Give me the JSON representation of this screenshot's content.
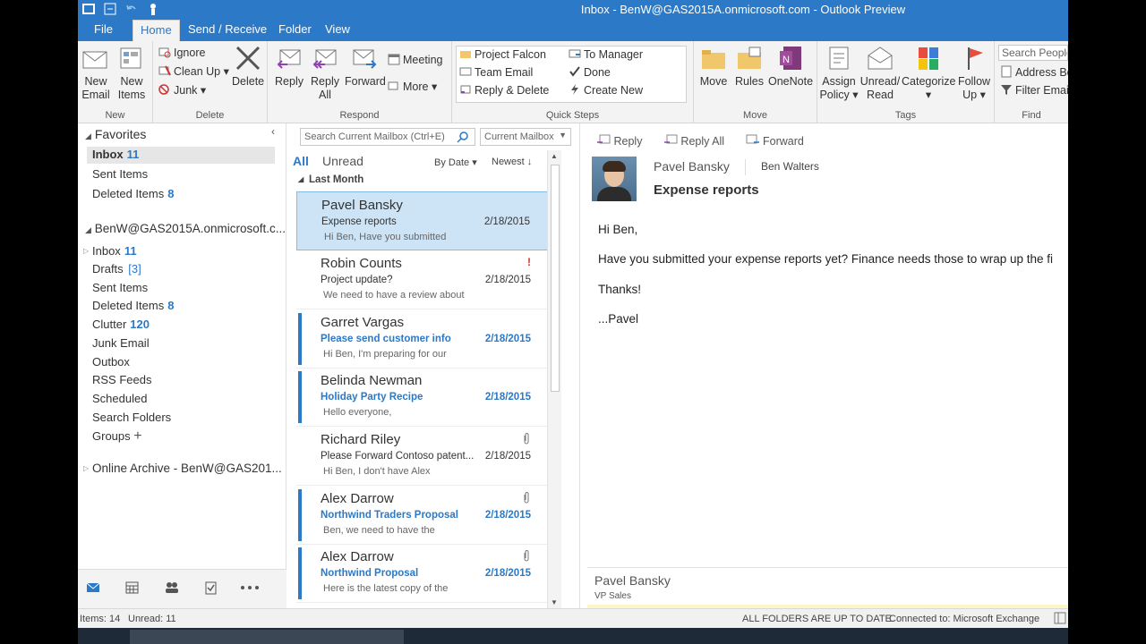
{
  "window": {
    "title": "Inbox - BenW@GAS2015A.onmicrosoft.com - Outlook Preview"
  },
  "tabs": [
    "File",
    "Home",
    "Send / Receive",
    "Folder",
    "View"
  ],
  "ribbon": {
    "new_email": "New Email",
    "new_items": "New Items",
    "group_new": "New",
    "ignore": "Ignore",
    "clean_up": "Clean Up",
    "junk": "Junk",
    "delete": "Delete",
    "group_delete": "Delete",
    "reply": "Reply",
    "reply_all": "Reply All",
    "forward": "Forward",
    "meeting": "Meeting",
    "more": "More",
    "group_respond": "Respond",
    "qs_project_falcon": "Project Falcon",
    "qs_team_email": "Team Email",
    "qs_reply_delete": "Reply & Delete",
    "qs_to_manager": "To Manager",
    "qs_done": "Done",
    "qs_create_new": "Create New",
    "group_quick_steps": "Quick Steps",
    "move": "Move",
    "rules": "Rules",
    "onenote": "OneNote",
    "group_move": "Move",
    "assign_policy": "Assign Policy",
    "unread_read": "Unread/ Read",
    "categorize": "Categorize",
    "follow_up": "Follow Up",
    "group_tags": "Tags",
    "search_people": "Search People",
    "address_book": "Address Bo",
    "filter_email": "Filter Email",
    "group_find": "Find"
  },
  "folders": {
    "favorites": "Favorites",
    "fav_inbox": "Inbox",
    "fav_inbox_count": "11",
    "fav_sent": "Sent Items",
    "fav_deleted": "Deleted Items",
    "fav_deleted_count": "8",
    "account": "BenW@GAS2015A.onmicrosoft.c...",
    "inbox": "Inbox",
    "inbox_count": "11",
    "drafts": "Drafts",
    "drafts_count": "[3]",
    "sent": "Sent Items",
    "deleted": "Deleted Items",
    "deleted_count": "8",
    "clutter": "Clutter",
    "clutter_count": "120",
    "junk": "Junk Email",
    "outbox": "Outbox",
    "rss": "RSS Feeds",
    "scheduled": "Scheduled",
    "search_folders": "Search Folders",
    "groups": "Groups",
    "archive": "Online Archive - BenW@GAS201..."
  },
  "list": {
    "search_placeholder": "Search Current Mailbox (Ctrl+E)",
    "scope": "Current Mailbox",
    "filter_all": "All",
    "filter_unread": "Unread",
    "sort_by": "By Date",
    "sort_order": "Newest",
    "group_label": "Last Month",
    "messages": [
      {
        "from": "Pavel Bansky",
        "subject": "Expense reports",
        "date": "2/18/2015",
        "preview": "Hi Ben,  Have you submitted"
      },
      {
        "from": "Robin Counts",
        "subject": "Project update?",
        "date": "2/18/2015",
        "preview": "We need to have a review about",
        "flag": "!"
      },
      {
        "from": "Garret Vargas",
        "subject": "Please send customer info",
        "date": "2/18/2015",
        "preview": "Hi Ben,  I'm preparing for our"
      },
      {
        "from": "Belinda Newman",
        "subject": "Holiday Party Recipe",
        "date": "2/18/2015",
        "preview": "Hello everyone,"
      },
      {
        "from": "Richard Riley",
        "subject": "Please Forward Contoso patent...",
        "date": "2/18/2015",
        "preview": "Hi Ben,  I don't have Alex"
      },
      {
        "from": "Alex Darrow",
        "subject": "Northwind Traders Proposal",
        "date": "2/18/2015",
        "preview": "Ben, we need to have the"
      },
      {
        "from": "Alex Darrow",
        "subject": "Northwind Proposal",
        "date": "2/18/2015",
        "preview": "Here is the latest copy of the"
      }
    ]
  },
  "reading": {
    "reply": "Reply",
    "reply_all": "Reply All",
    "forward": "Forward",
    "from": "Pavel Bansky",
    "to": "Ben Walters",
    "subject": "Expense reports",
    "body_1": "Hi Ben,",
    "body_2": "Have you submitted your expense reports yet?  Finance needs those to wrap up the fi",
    "body_3": "Thanks!",
    "body_4": "...Pavel",
    "sig_name": "Pavel Bansky",
    "sig_title": "VP Sales"
  },
  "status": {
    "items": "Items: 14",
    "unread": "Unread: 11",
    "sync": "ALL FOLDERS ARE UP TO DATE.",
    "connection": "Connected to: Microsoft Exchange"
  }
}
